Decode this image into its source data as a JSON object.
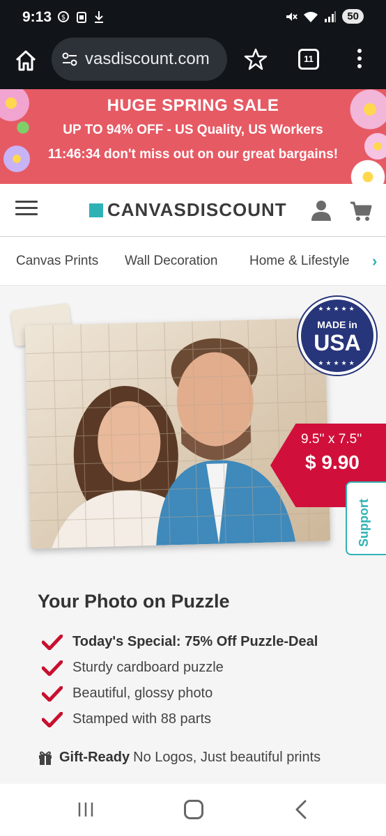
{
  "status_bar": {
    "time": "9:13",
    "battery": "50",
    "left_icons": [
      "data-saver-icon",
      "sim-icon",
      "download-icon"
    ],
    "right_icons": [
      "mute-icon",
      "wifi-icon",
      "signal-icon"
    ]
  },
  "browser": {
    "url": "vasdiscount.com",
    "tab_count": "11"
  },
  "promo": {
    "title": "HUGE SPRING SALE",
    "subtitle": "UP TO 94% OFF - US Quality, US Workers",
    "timer_text": "11:46:34 don't miss out on our great bargains!",
    "background_color": "#e65a64"
  },
  "header": {
    "logo_text": "CANVASDISCOUNT",
    "logo_color": "#2fb2b5"
  },
  "categories": [
    {
      "label": "Canvas Prints"
    },
    {
      "label": "Wall Decoration"
    },
    {
      "label": "Home & Lifestyle"
    }
  ],
  "hero": {
    "badge_top": "MADE in",
    "badge_main": "USA",
    "price_size": "9.5'' x 7.5''",
    "price": "$ 9.90",
    "price_color": "#d0103a",
    "support_label": "Support"
  },
  "product": {
    "title": "Your Photo on Puzzle",
    "features": [
      {
        "text": "Today's Special: 75% Off Puzzle-Deal",
        "emphasis": true
      },
      {
        "text": "Sturdy cardboard puzzle",
        "emphasis": false
      },
      {
        "text": "Beautiful, glossy photo",
        "emphasis": false
      },
      {
        "text": "Stamped with 88 parts",
        "emphasis": false
      }
    ],
    "gift_strong": "Gift-Ready",
    "gift_text": "No Logos, Just beautiful prints"
  }
}
